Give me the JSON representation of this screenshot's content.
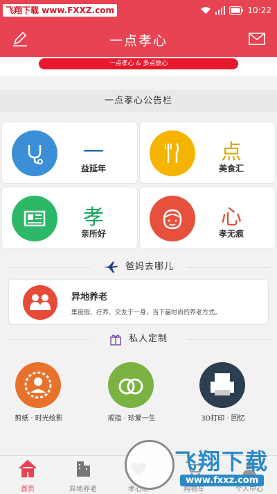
{
  "status": {
    "watermark": "飞翔下载 www.FXXZ.com",
    "time": "10:22"
  },
  "header": {
    "title": "一点孝心",
    "edit_icon": "edit-icon",
    "mail_icon": "mail-icon"
  },
  "banner": {
    "text": "一点孝心 & 多点放心"
  },
  "notice": {
    "text": "一点孝心公告栏"
  },
  "cards": [
    {
      "label": "益延年",
      "glyph": "一",
      "glyph_color": "#1e6fb0",
      "circle_color": "#3a8fd6",
      "icon": "stethoscope-icon"
    },
    {
      "label": "美食汇",
      "glyph": "点",
      "glyph_color": "#e0a800",
      "circle_color": "#f4b400",
      "icon": "fork-knife-icon"
    },
    {
      "label": "亲所好",
      "glyph": "孝",
      "glyph_color": "#1aa260",
      "circle_color": "#2cb866",
      "icon": "newspaper-icon"
    },
    {
      "label": "孝无痕",
      "glyph": "心",
      "glyph_color": "#e64b3a",
      "circle_color": "#e8503e",
      "icon": "face-icon"
    }
  ],
  "section_travel": {
    "text": "爸妈去哪儿",
    "icon": "airplane-icon"
  },
  "elder": {
    "title": "异地养老",
    "desc": "集度假、疗养、交友于一身，当下最时尚的养老方式。",
    "icon": "family-icon"
  },
  "section_custom": {
    "text": "私人定制",
    "icon": "gift-icon"
  },
  "services": [
    {
      "label": "剪纸 · 时光绘影",
      "color": "#e8722c",
      "icon": "papercut-icon"
    },
    {
      "label": "戒指 · 珍爱一生",
      "color": "#7ab342",
      "icon": "rings-icon"
    },
    {
      "label": "3D打印 · 回忆",
      "color": "#2c3e50",
      "icon": "printer-icon"
    }
  ],
  "tabs": [
    {
      "label": "首页",
      "icon": "home-icon",
      "active": true
    },
    {
      "label": "异地养老",
      "icon": "building-icon",
      "active": false
    },
    {
      "label": "孝心汇",
      "icon": "heart-icon",
      "active": false
    },
    {
      "label": "购物车",
      "icon": "cart-icon",
      "active": false
    },
    {
      "label": "个人中心",
      "icon": "user-icon",
      "active": false
    }
  ],
  "bottom_watermark": {
    "text": "飞翔下载",
    "url": "www.fxxz.com"
  },
  "colors": {
    "primary": "#e84352",
    "watermark_blue": "#2d8ac6"
  }
}
